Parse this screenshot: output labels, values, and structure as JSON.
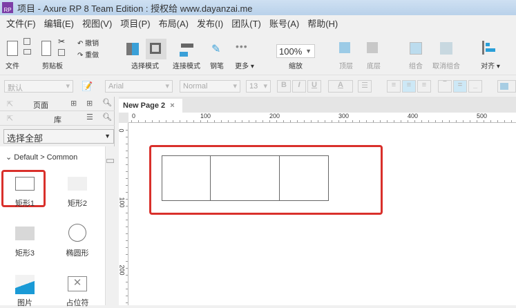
{
  "title": {
    "logo": "RP",
    "text": "项目 - Axure RP 8 Team Edition : 授权给 www.dayanzai.me"
  },
  "menu": [
    "文件(F)",
    "编辑(E)",
    "视图(V)",
    "项目(P)",
    "布局(A)",
    "发布(I)",
    "团队(T)",
    "账号(A)",
    "帮助(H)"
  ],
  "toolbar": {
    "file": "文件",
    "clipboard": "剪贴板",
    "undo": "撤销",
    "redo": "重做",
    "select_mode": "选择模式",
    "connect_mode": "连接模式",
    "pen": "钢笔",
    "more": "更多 ▾",
    "zoom_value": "100%",
    "zoom": "缩放",
    "top": "顶层",
    "bottom": "底层",
    "group": "组合",
    "ungroup": "取消组合",
    "align": "对齐 ▾"
  },
  "format": {
    "style": "默认",
    "font": "Arial",
    "weight": "Normal",
    "size": "13",
    "bold": "B",
    "italic": "I",
    "underline": "U",
    "color": "A"
  },
  "left": {
    "pages": "页面",
    "library": "库",
    "library_select": "选择全部",
    "category": "Default > Common",
    "widgets": [
      "矩形1",
      "矩形2",
      "矩形3",
      "椭圆形",
      "图片",
      "占位符"
    ]
  },
  "canvas": {
    "tab": "New Page 2",
    "tab_close": "×",
    "h_ticks": [
      "0",
      "100",
      "200",
      "300",
      "400",
      "500"
    ],
    "v_ticks": [
      "0",
      "100",
      "200"
    ]
  },
  "colors": {
    "highlight": "#d9302b",
    "accent": "#2a9fd8"
  }
}
